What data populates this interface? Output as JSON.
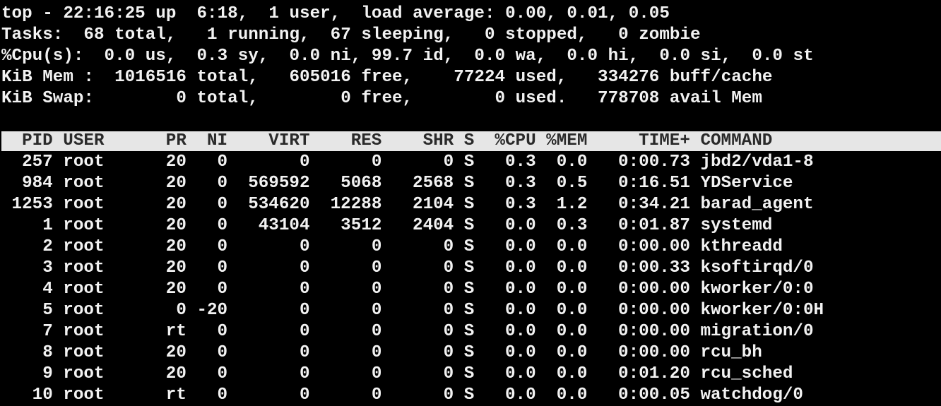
{
  "summary": {
    "uptime_line": "top - 22:16:25 up  6:18,  1 user,  load average: 0.00, 0.01, 0.05",
    "tasks_line": "Tasks:  68 total,   1 running,  67 sleeping,   0 stopped,   0 zombie",
    "cpu_line": "%Cpu(s):  0.0 us,  0.3 sy,  0.0 ni, 99.7 id,  0.0 wa,  0.0 hi,  0.0 si,  0.0 st",
    "mem_line": "KiB Mem :  1016516 total,   605016 free,    77224 used,   334276 buff/cache",
    "swap_line": "KiB Swap:        0 total,        0 free,        0 used.   778708 avail Mem"
  },
  "columns": [
    "PID",
    "USER",
    "PR",
    "NI",
    "VIRT",
    "RES",
    "SHR",
    "S",
    "%CPU",
    "%MEM",
    "TIME+",
    "COMMAND"
  ],
  "processes": [
    [
      "257",
      "root",
      "20",
      "0",
      "0",
      "0",
      "0",
      "S",
      "0.3",
      "0.0",
      "0:00.73",
      "jbd2/vda1-8"
    ],
    [
      "984",
      "root",
      "20",
      "0",
      "569592",
      "5068",
      "2568",
      "S",
      "0.3",
      "0.5",
      "0:16.51",
      "YDService"
    ],
    [
      "1253",
      "root",
      "20",
      "0",
      "534620",
      "12288",
      "2104",
      "S",
      "0.3",
      "1.2",
      "0:34.21",
      "barad_agent"
    ],
    [
      "1",
      "root",
      "20",
      "0",
      "43104",
      "3512",
      "2404",
      "S",
      "0.0",
      "0.3",
      "0:01.87",
      "systemd"
    ],
    [
      "2",
      "root",
      "20",
      "0",
      "0",
      "0",
      "0",
      "S",
      "0.0",
      "0.0",
      "0:00.00",
      "kthreadd"
    ],
    [
      "3",
      "root",
      "20",
      "0",
      "0",
      "0",
      "0",
      "S",
      "0.0",
      "0.0",
      "0:00.33",
      "ksoftirqd/0"
    ],
    [
      "4",
      "root",
      "20",
      "0",
      "0",
      "0",
      "0",
      "S",
      "0.0",
      "0.0",
      "0:00.00",
      "kworker/0:0"
    ],
    [
      "5",
      "root",
      "0",
      "-20",
      "0",
      "0",
      "0",
      "S",
      "0.0",
      "0.0",
      "0:00.00",
      "kworker/0:0H"
    ],
    [
      "7",
      "root",
      "rt",
      "0",
      "0",
      "0",
      "0",
      "S",
      "0.0",
      "0.0",
      "0:00.00",
      "migration/0"
    ],
    [
      "8",
      "root",
      "20",
      "0",
      "0",
      "0",
      "0",
      "S",
      "0.0",
      "0.0",
      "0:00.00",
      "rcu_bh"
    ],
    [
      "9",
      "root",
      "20",
      "0",
      "0",
      "0",
      "0",
      "S",
      "0.0",
      "0.0",
      "0:01.20",
      "rcu_sched"
    ],
    [
      "10",
      "root",
      "rt",
      "0",
      "0",
      "0",
      "0",
      "S",
      "0.0",
      "0.0",
      "0:00.05",
      "watchdog/0"
    ]
  ]
}
